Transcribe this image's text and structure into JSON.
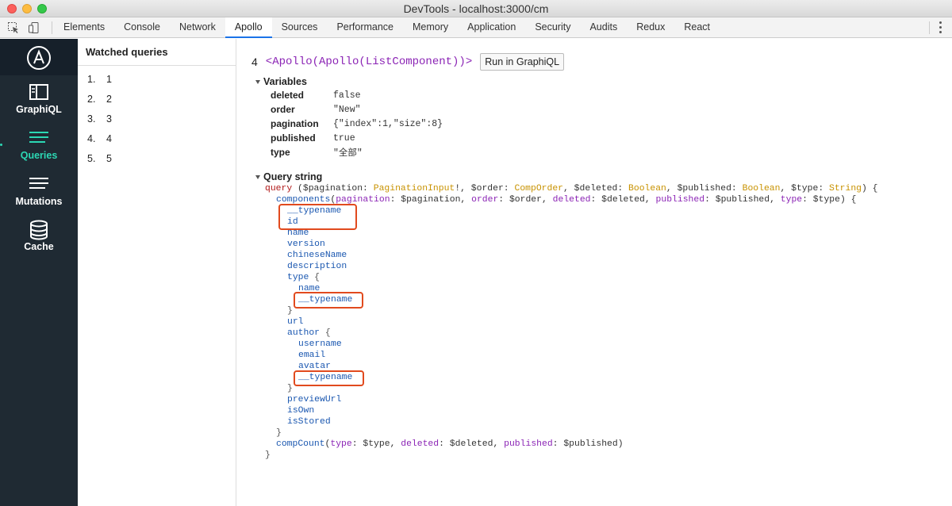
{
  "window": {
    "title": "DevTools - localhost:3000/cm"
  },
  "tabs": [
    "Elements",
    "Console",
    "Network",
    "Apollo",
    "Sources",
    "Performance",
    "Memory",
    "Application",
    "Security",
    "Audits",
    "Redux",
    "React"
  ],
  "active_tab": "Apollo",
  "sidebar": {
    "items": [
      {
        "label": "GraphiQL",
        "icon": "graphiql-icon"
      },
      {
        "label": "Queries",
        "icon": "queries-icon",
        "active": true
      },
      {
        "label": "Mutations",
        "icon": "mutations-icon"
      },
      {
        "label": "Cache",
        "icon": "cache-icon"
      }
    ],
    "accent": "#2cd8b4"
  },
  "watched": {
    "title": "Watched queries",
    "items": [
      {
        "num": "1.",
        "label": "1"
      },
      {
        "num": "2.",
        "label": "2"
      },
      {
        "num": "3.",
        "label": "3"
      },
      {
        "num": "4.",
        "label": "4"
      },
      {
        "num": "5.",
        "label": "5"
      }
    ]
  },
  "query": {
    "id": "4",
    "component": "<Apollo(Apollo(ListComponent))>",
    "run_button": "Run in GraphiQL",
    "variables_label": "Variables",
    "variables": [
      {
        "key": "deleted",
        "value": "false"
      },
      {
        "key": "order",
        "value": "\"New\""
      },
      {
        "key": "pagination",
        "value": "{\"index\":1,\"size\":8}"
      },
      {
        "key": "published",
        "value": "true"
      },
      {
        "key": "type",
        "value": "\"全部\""
      }
    ],
    "query_string_label": "Query string"
  },
  "code": {
    "l1": {
      "kw": "query",
      "a": " ($pagination: ",
      "t1": "PaginationInput",
      "b": "!, $order: ",
      "t2": "CompOrder",
      "c": ", $deleted: ",
      "t3": "Boolean",
      "d": ", $published: ",
      "t4": "Boolean",
      "e": ", $type: ",
      "t5": "String",
      "f": ") {"
    },
    "l2": {
      "fld": "components",
      "a": "(",
      "arg1": "pagination",
      "b": ": $pagination, ",
      "arg2": "order",
      "c": ": $order, ",
      "arg3": "deleted",
      "d": ": $deleted, ",
      "arg4": "published",
      "e": ": $published, ",
      "arg5": "type",
      "f": ": $type) {"
    },
    "fields_1": [
      "__typename",
      "id",
      "name",
      "version",
      "chineseName",
      "description"
    ],
    "type_field": "type",
    "type_sub": [
      "name",
      "__typename"
    ],
    "url_field": "url",
    "author_field": "author",
    "author_sub": [
      "username",
      "email",
      "avatar",
      "__typename"
    ],
    "fields_2": [
      "previewUrl",
      "isOwn",
      "isStored"
    ],
    "l_count": {
      "fld": "compCount",
      "a": "(",
      "arg1": "type",
      "b": ": $type, ",
      "arg2": "deleted",
      "c": ": $deleted, ",
      "arg3": "published",
      "d": ": $published)"
    },
    "open_brace": " {",
    "close_brace": "}"
  },
  "highlight_color": "#e14a1e"
}
